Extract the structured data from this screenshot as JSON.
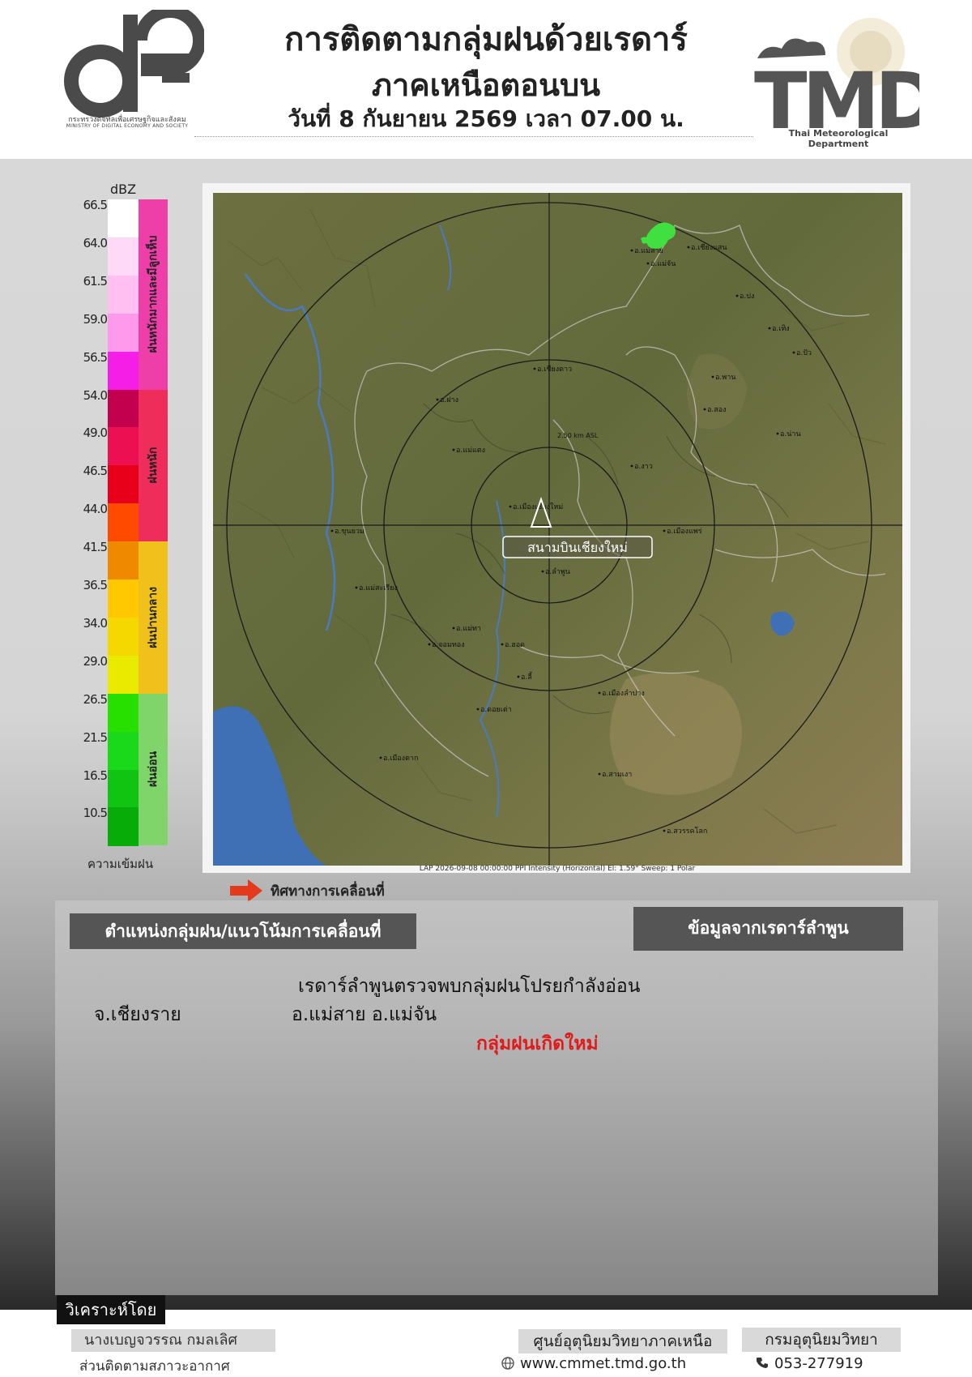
{
  "header": {
    "ministry_name_th": "กระทรวงดิจิทัลเพื่อเศรษฐกิจและสังคม",
    "ministry_name_en": "MINISTRY OF DIGITAL ECONOMY AND SOCIETY",
    "title_line1": "การติดตามกลุ่มฝนด้วยเรดาร์",
    "title_line2": "ภาคเหนือตอนบน",
    "title_line3": "วันที่ 8 กันยายน 2569 เวลา 07.00 น.",
    "tmd_logo_text": "TMD",
    "tmd_subtitle": "Thai Meteorological Department"
  },
  "legend": {
    "unit": "dBZ",
    "values": [
      "66.5",
      "64.0",
      "61.5",
      "59.0",
      "56.5",
      "54.0",
      "49.0",
      "46.5",
      "44.0",
      "41.5",
      "36.5",
      "34.0",
      "29.0",
      "26.5",
      "21.5",
      "16.5",
      "10.5"
    ],
    "colors": [
      "#ffffff",
      "#ffd9f7",
      "#ffbff0",
      "#ff99ec",
      "#f51ee6",
      "#c2004e",
      "#ec0f52",
      "#e8001a",
      "#ff4a00",
      "#ee8900",
      "#ffc800",
      "#f4d800",
      "#eaea00",
      "#28e000",
      "#1ad81a",
      "#12c412",
      "#08ac08"
    ],
    "categories": [
      {
        "label": "ฝนหนักมากและมีลูกเห็บ",
        "color": "#ee3fa8"
      },
      {
        "label": "ฝนหนัก",
        "color": "#ee2d5a"
      },
      {
        "label": "ฝนปานกลาง",
        "color": "#f1c11b"
      },
      {
        "label": "ฝนอ่อน",
        "color": "#7fd46a"
      }
    ],
    "footer": "ความเข้มฝน"
  },
  "map": {
    "airport_label": "สนามบินเชียงใหม่",
    "caption": "LAP 2026-09-08 00:00:00 PPI Intensity (Horizontal) El: 1.59° Sweep: 1 Polar",
    "range_label": "2.50 km ASL",
    "place_labels": [
      "อ.แม่สาย",
      "อ.เชียงแสน",
      "อ.แม่จัน",
      "อ.ฝาง",
      "อ.เมืองเชียงใหม่",
      "อ.ลำพูน",
      "อ.แม่ทา",
      "อ.ฮอด",
      "อ.ลี้",
      "อ.พาน",
      "อ.เทิง",
      "อ.ปง",
      "อ.เมืองลำปาง",
      "อ.งาว",
      "อ.เมืองแพร่",
      "อ.น่าน",
      "อ.สอง",
      "อ.ปัว",
      "อ.แม่สะเรียง",
      "อ.ขุนยวม",
      "อ.เมืองตาก",
      "อ.สวรรคโลก",
      "อ.เชียงดาว",
      "อ.แม่แตง",
      "อ.จอมทอง",
      "อ.ดอยเต่า",
      "อ.สามเงา"
    ]
  },
  "direction_label": "ทิศทางการเคลื่อนที่",
  "panel": {
    "left_title": "ตำแหน่งกลุ่มฝน/แนวโน้มการเคลื่อนที่",
    "right_title": "ข้อมูลจากเรดาร์ลำพูน",
    "detection_text": "เรดาร์ลำพูนตรวจพบกลุ่มฝนโปรยกำลังอ่อน",
    "province": "จ.เชียงราย",
    "districts": "อ.แม่สาย อ.แม่จัน",
    "new_cell": "กลุ่มฝนเกิดใหม่"
  },
  "footer": {
    "analyzed_by": "วิเคราะห์โดย",
    "analyst_name": "นางเบญจวรรณ กมลเลิศ",
    "analyst_unit": "ส่วนติดตามสภาวะอากาศ",
    "center_name": "ศูนย์อุตุนิยมวิทยาภาคเหนือ",
    "dept_name": "กรมอุตุนิยมวิทยา",
    "website": "www.cmmet.tmd.go.th",
    "phone": "053-277919"
  }
}
